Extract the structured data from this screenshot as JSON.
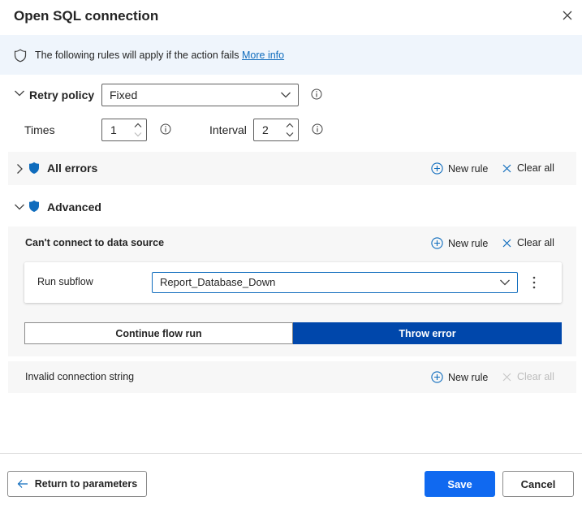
{
  "dialog": {
    "title": "Open SQL connection"
  },
  "banner": {
    "text": "The following rules will apply if the action fails",
    "link": "More info"
  },
  "retry": {
    "label": "Retry policy",
    "policy_value": "Fixed",
    "times_label": "Times",
    "times_value": "1",
    "interval_label": "Interval",
    "interval_value": "2"
  },
  "all_errors": {
    "label": "All errors",
    "new_rule": "New rule",
    "clear_all": "Clear all"
  },
  "advanced": {
    "label": "Advanced",
    "rules": [
      {
        "title": "Can't connect to data source",
        "new_rule": "New rule",
        "clear_all": "Clear all",
        "action_label": "Run subflow",
        "action_value": "Report_Database_Down",
        "mode_continue": "Continue flow run",
        "mode_throw": "Throw error",
        "selected_mode": "Throw error"
      },
      {
        "title": "Invalid connection string",
        "new_rule": "New rule",
        "clear_all": "Clear all"
      }
    ]
  },
  "footer": {
    "back": "Return to parameters",
    "save": "Save",
    "cancel": "Cancel"
  },
  "colors": {
    "accent": "#0f6cbd",
    "primary_button": "#1069f0",
    "selected_segment": "#0047ab",
    "shield": "#0f6cbd"
  }
}
